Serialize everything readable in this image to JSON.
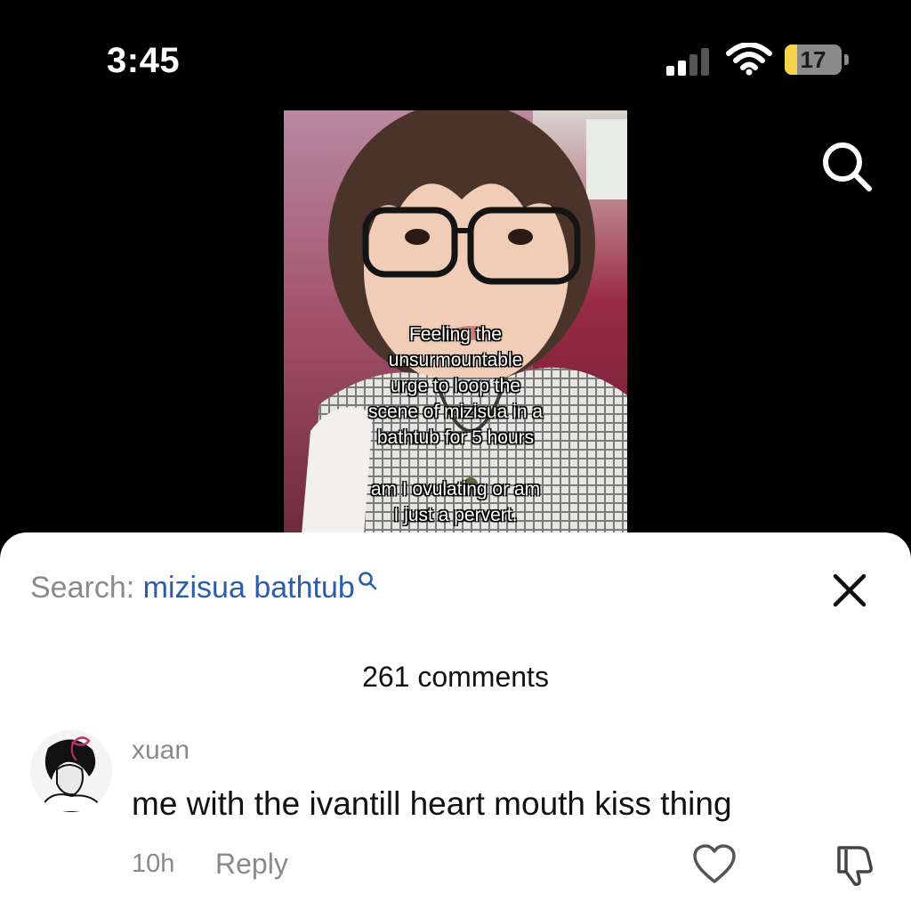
{
  "status_bar": {
    "time": "3:45",
    "battery_percent": "17",
    "battery_level": 0.17,
    "signal_bars": 2,
    "icons": [
      "cellular-signal-icon",
      "wifi-icon",
      "battery-icon"
    ]
  },
  "top_bar": {
    "search_icon": "search-icon"
  },
  "video": {
    "caption": "Feeling the\nunsurmountable\nurge to loop the\nscene of mizisua in a\nbathtub for 5 hours\n\nam I ovulating or am\nI just a pervert."
  },
  "comments_sheet": {
    "search_prefix": "Search: ",
    "search_query": "mizisua bathtub",
    "close_icon": "close-icon",
    "comment_count_label": "261 comments",
    "comments": [
      {
        "username": "xuan",
        "text": "me with the ivantill heart mouth kiss thing",
        "time": "10h",
        "reply_label": "Reply"
      }
    ]
  },
  "colors": {
    "background_dark": "#000000",
    "sheet_background": "#ffffff",
    "search_query_blue": "#2b5da8",
    "muted_gray": "#8a8a8a",
    "battery_yellow": "#f6d34a"
  }
}
